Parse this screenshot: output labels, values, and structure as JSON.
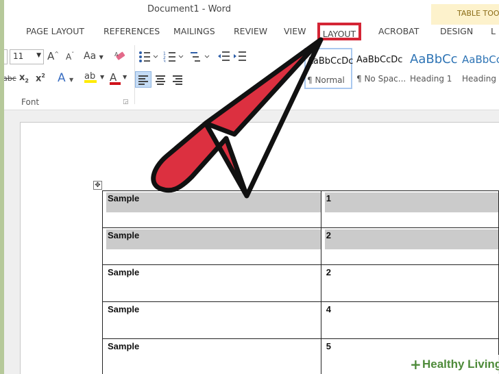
{
  "window": {
    "title": "Document1 - Word"
  },
  "contextual_tab": {
    "label": "TABLE TOO"
  },
  "tabs": [
    {
      "label": "PAGE LAYOUT"
    },
    {
      "label": "REFERENCES"
    },
    {
      "label": "MAILINGS"
    },
    {
      "label": "REVIEW"
    },
    {
      "label": "VIEW"
    },
    {
      "label": "LAYOUT",
      "highlighted": true
    },
    {
      "label": "ACROBAT"
    },
    {
      "label": "DESIGN"
    },
    {
      "label": "L"
    }
  ],
  "ribbon": {
    "font_size": "11",
    "grow_font": "A",
    "shrink_font": "A",
    "change_case": "Aa",
    "strikethrough": "abc",
    "subscript": "x",
    "subscript_mark": "2",
    "superscript": "x",
    "superscript_mark": "2",
    "text_effects": "A",
    "highlight": "ab",
    "font_color": "A",
    "font_group_label": "Font",
    "styles": [
      {
        "preview": "AaBbCcDc",
        "name": "¶ Normal",
        "selected": true
      },
      {
        "preview": "AaBbCcDc",
        "name": "¶ No Spac..."
      },
      {
        "preview": "AaBbCc",
        "name": "Heading 1"
      },
      {
        "preview": "AaBbCc",
        "name": "Heading"
      }
    ]
  },
  "table": {
    "rows": [
      {
        "label": "Sample",
        "value": "1",
        "shaded": true
      },
      {
        "label": "Sample",
        "value": "2",
        "shaded": true
      },
      {
        "label": "Sample",
        "value": "2",
        "shaded": false
      },
      {
        "label": "Sample",
        "value": "4",
        "shaded": false
      },
      {
        "label": "Sample",
        "value": "5",
        "shaded": false
      }
    ]
  },
  "overlay": {
    "arrow_color": "#dc3040",
    "highlight_color": "#d42535"
  },
  "watermark": {
    "plus": "+",
    "text": "Healthy Living"
  }
}
